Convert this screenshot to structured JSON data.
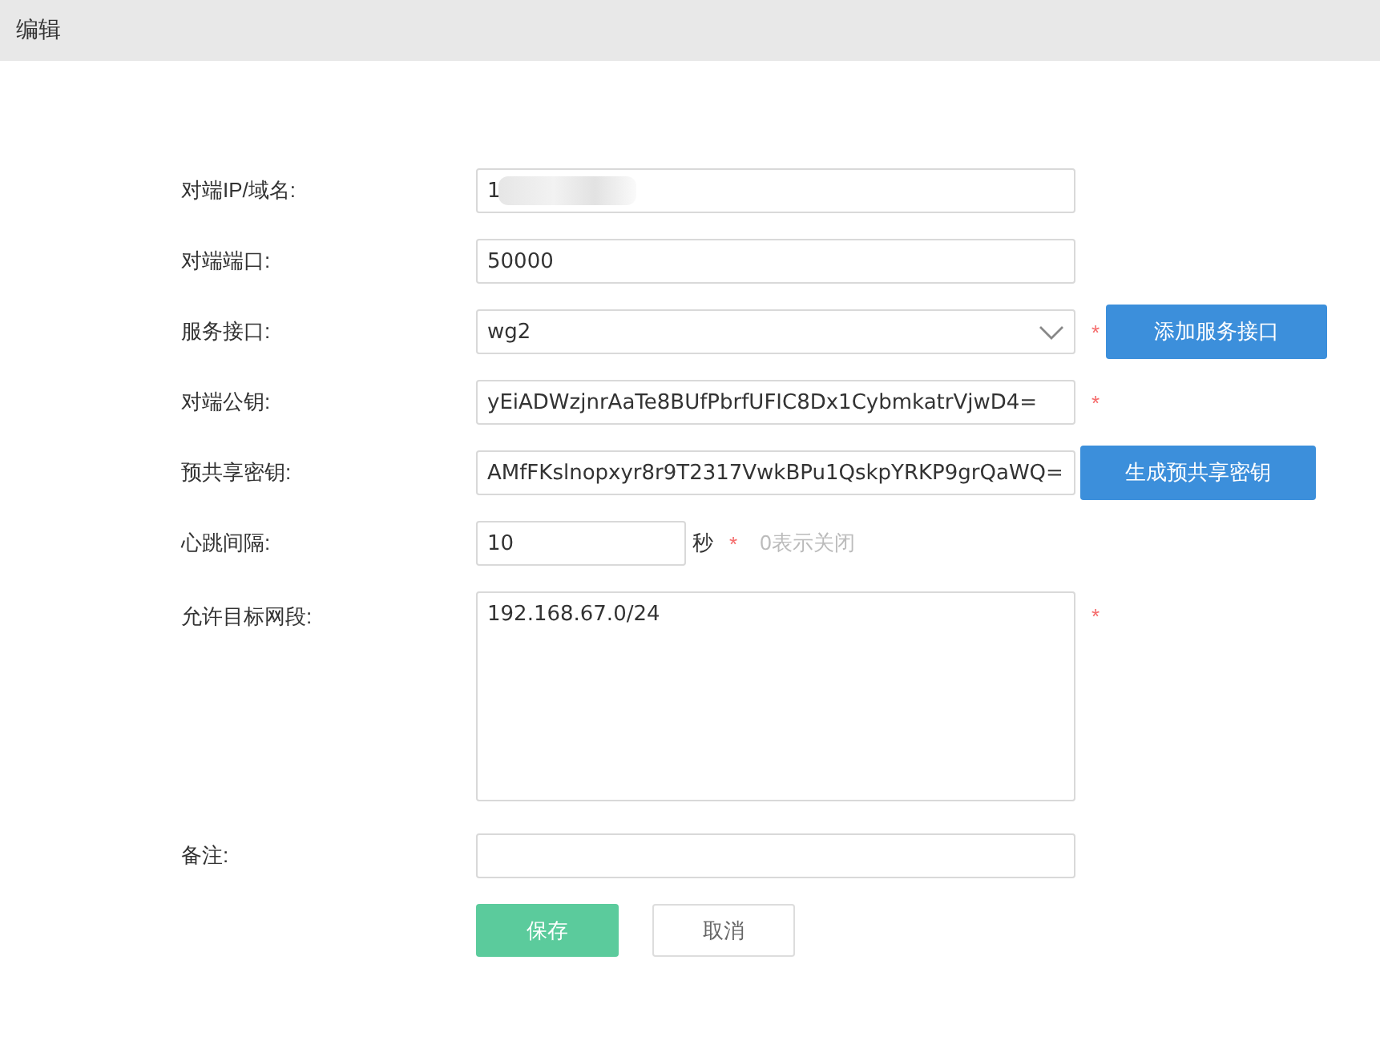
{
  "header": {
    "title": "编辑"
  },
  "fields": [
    {
      "kind": "text",
      "label": "对端IP/域名:",
      "value": "1",
      "redacted": true
    },
    {
      "kind": "text",
      "label": "对端端口:",
      "value": "50000"
    },
    {
      "kind": "select",
      "label": "服务接口:",
      "value": "wg2",
      "required_mark": "*",
      "action": "添加服务接口"
    },
    {
      "kind": "text",
      "label": "对端公钥:",
      "value": "yEiADWzjnrAaTe8BUfPbrfUFIC8Dx1CybmkatrVjwD4=",
      "required_mark": "*"
    },
    {
      "kind": "text",
      "label": "预共享密钥:",
      "value": "AMfFKslnopxyr8r9T2317VwkBPu1QskpYRKP9grQaWQ=",
      "action": "生成预共享密钥"
    },
    {
      "kind": "number",
      "label": "心跳间隔:",
      "value": "10",
      "unit": "秒",
      "required_mark": "*",
      "hint": "0表示关闭"
    },
    {
      "kind": "textarea",
      "label": "允许目标网段:",
      "value": "192.168.67.0/24",
      "required_mark": "*"
    },
    {
      "kind": "text",
      "label": "备注:"
    }
  ],
  "buttons": {
    "save": "保存",
    "cancel": "取消"
  }
}
